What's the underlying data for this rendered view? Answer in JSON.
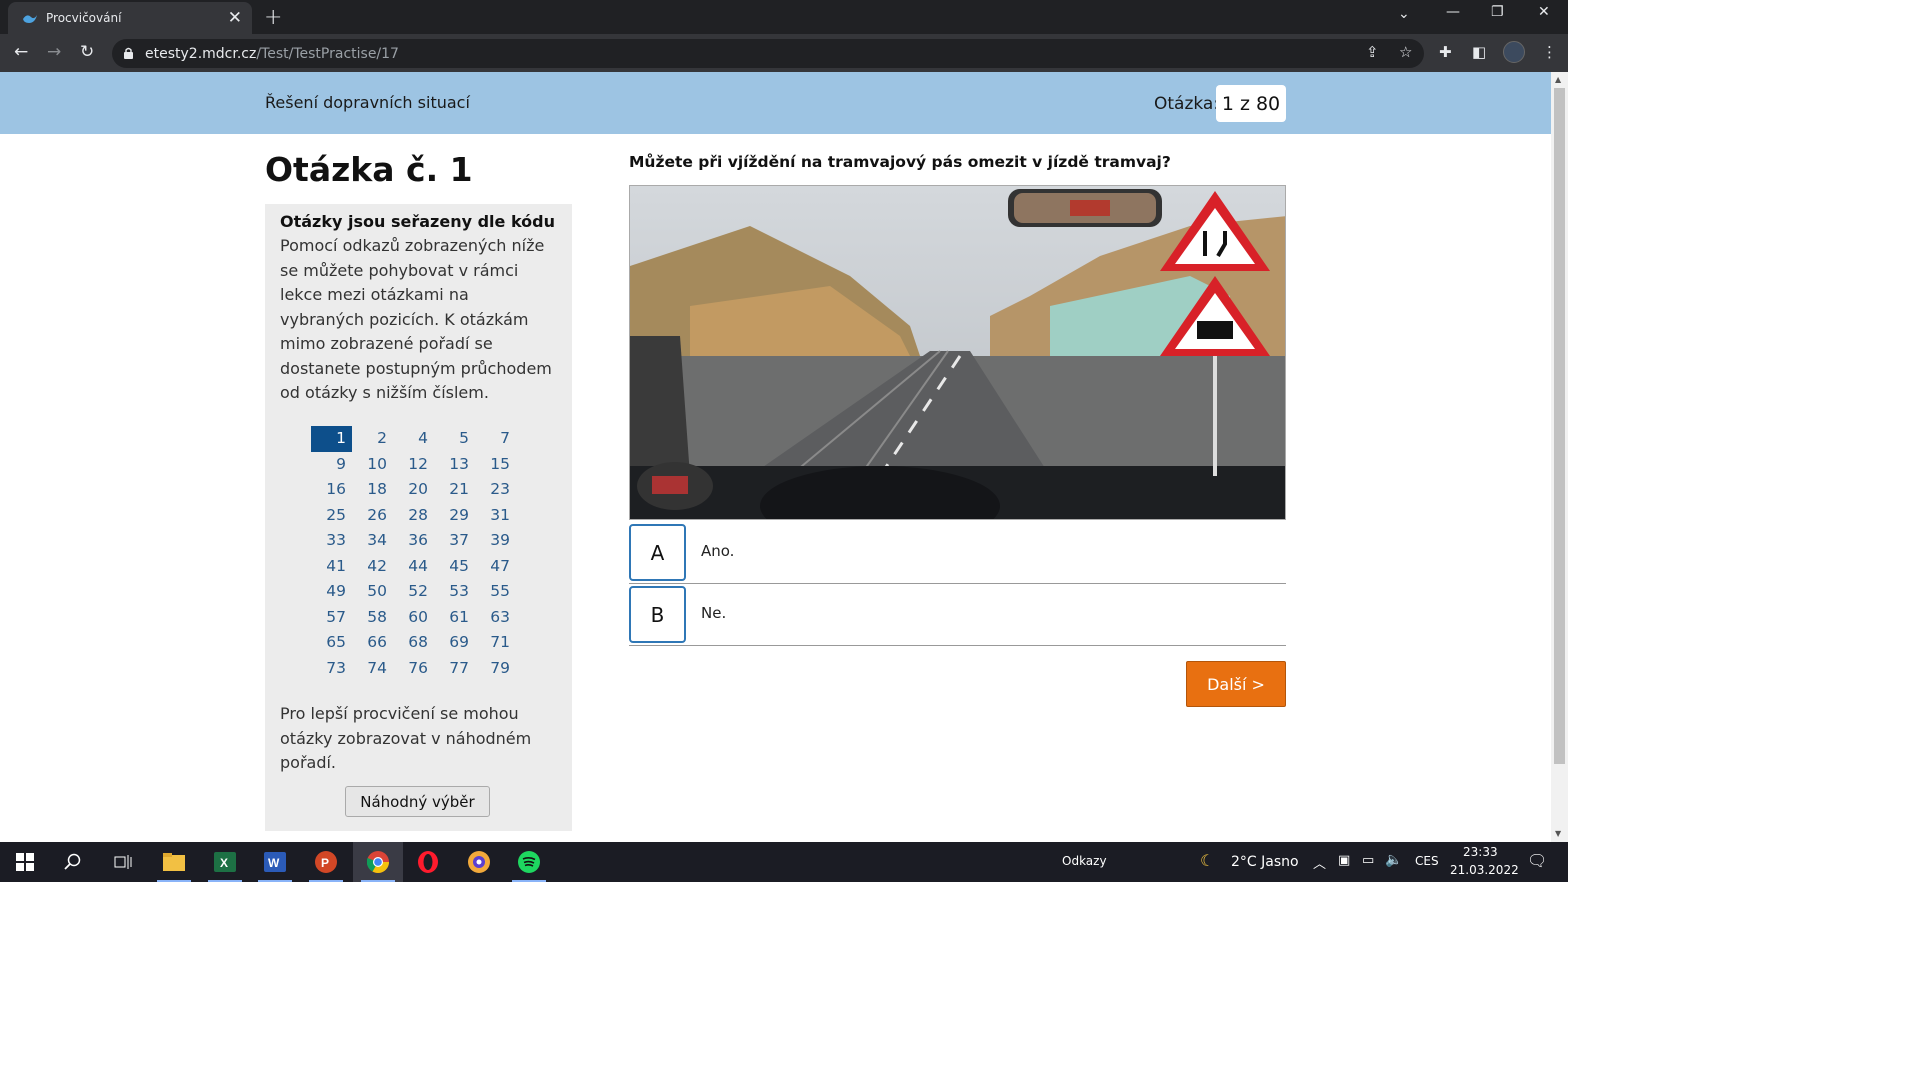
{
  "browser": {
    "tab_title": "Procvičování",
    "url_host": "etesty2.mdcr.cz",
    "url_path": "/Test/TestPractise/17"
  },
  "header": {
    "section_title": "Řešení dopravních situací",
    "counter_label": "Otázka:",
    "counter_value": "1 z 80"
  },
  "main": {
    "question_heading": "Otázka č. 1",
    "question_text": "Můžete při vjíždění na tramvajový pás omezit v jízdě tramvaj?",
    "answers": [
      {
        "letter": "A",
        "text": "Ano."
      },
      {
        "letter": "B",
        "text": "Ne."
      }
    ],
    "next_label": "Další >"
  },
  "sidebar": {
    "heading": "Otázky jsou seřazeny dle kódu",
    "text": "Pomocí odkazů zobrazených níže se můžete pohybovat v rámci lekce mezi otázkami na vybraných pozicích. K otázkám mimo zobrazené pořadí se dostanete postupným průchodem od otázky s nižším číslem.",
    "numbers": [
      "1",
      "2",
      "4",
      "5",
      "7",
      "9",
      "10",
      "12",
      "13",
      "15",
      "16",
      "18",
      "20",
      "21",
      "23",
      "25",
      "26",
      "28",
      "29",
      "31",
      "33",
      "34",
      "36",
      "37",
      "39",
      "41",
      "42",
      "44",
      "45",
      "47",
      "49",
      "50",
      "52",
      "53",
      "55",
      "57",
      "58",
      "60",
      "61",
      "63",
      "65",
      "66",
      "68",
      "69",
      "71",
      "73",
      "74",
      "76",
      "77",
      "79"
    ],
    "active_number": "1",
    "text2": "Pro lepší procvičení se mohou otázky zobrazovat v náhodném pořadí.",
    "random_label": "Náhodný výběr"
  },
  "taskbar": {
    "links_label": "Odkazy",
    "weather": "2°C  Jasno",
    "lang": "CES",
    "time": "23:33",
    "date": "21.03.2022"
  }
}
